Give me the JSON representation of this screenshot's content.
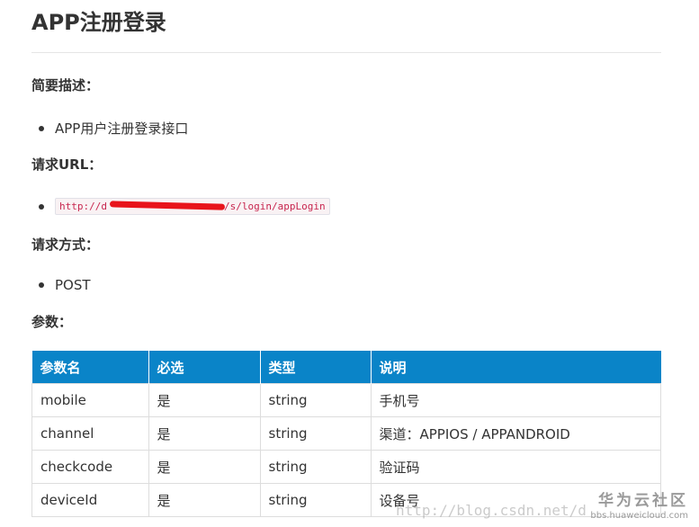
{
  "title": "APP注册登录",
  "sections": {
    "description_heading": "简要描述：",
    "description_item": "APP用户注册登录接口",
    "url_heading": "请求URL：",
    "url_value": "http://d[redacted]/s/login/appLogin",
    "url_prefix": "http://d",
    "url_suffix": "/s/login/appLogin",
    "method_heading": "请求方式：",
    "method_item": "POST",
    "params_heading": "参数："
  },
  "table": {
    "headers": [
      "参数名",
      "必选",
      "类型",
      "说明"
    ],
    "rows": [
      [
        "mobile",
        "是",
        "string",
        "手机号"
      ],
      [
        "channel",
        "是",
        "string",
        "渠道：APPIOS / APPANDROID"
      ],
      [
        "checkcode",
        "是",
        "string",
        "验证码"
      ],
      [
        "deviceId",
        "是",
        "string",
        "设备号"
      ]
    ]
  },
  "watermark": {
    "text": "http://blog.csdn.net/d",
    "brand": "华为云社区",
    "brand_url": "bbs.huaweicloud.com"
  },
  "colors": {
    "table_header_bg": "#0a84c8",
    "code_text": "#c7254e",
    "redaction": "#e8141b"
  }
}
